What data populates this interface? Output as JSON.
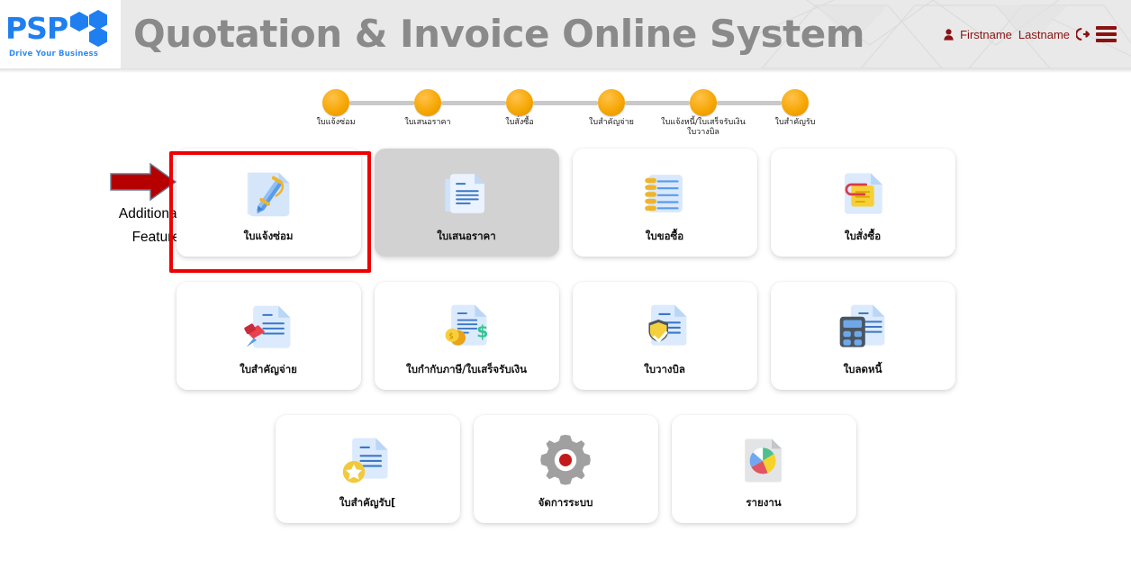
{
  "header": {
    "logo_text": "PSP",
    "logo_tagline": "Drive Your Business",
    "logo_icon": "hexagon-cluster-icon",
    "title": "Quotation & Invoice Online System",
    "user_icon": "user-icon",
    "first_name": "Firstname",
    "last_name": "Lastname",
    "logout_icon": "logout-icon",
    "menu_icon": "hamburger-menu-icon",
    "accent_color": "#8c1212",
    "title_color": "#8a8a8a",
    "bar_color": "#e9e9e9"
  },
  "stepper": {
    "dot_color": "#f5a500",
    "line_color": "#c9c9c9",
    "steps": [
      {
        "label": "ใบแจ้งซ่อม"
      },
      {
        "label": "ใบเสนอราคา"
      },
      {
        "label": "ใบสั่งซื้อ"
      },
      {
        "label": "ใบสำคัญจ่าย"
      },
      {
        "label": "ใบแจ้งหนี้/ใบเสร็จรับเงิน\nใบวางบิล"
      },
      {
        "label": "ใบสำคัญรับ"
      }
    ]
  },
  "annotation": {
    "line1": "Additional",
    "line2": "Feature",
    "arrow_icon": "right-arrow-icon",
    "arrow_color": "#b60000",
    "highlight_color": "#ee0000"
  },
  "cards": [
    {
      "label": "ใบแจ้งซ่อม",
      "icon": "document-pen-icon",
      "state": "highlighted"
    },
    {
      "label": "ใบเสนอราคา",
      "icon": "document-lines-icon",
      "state": "selected"
    },
    {
      "label": "ใบขอซื้อ",
      "icon": "notepad-icon",
      "state": "normal"
    },
    {
      "label": "ใบสั่งซื้อ",
      "icon": "document-paperclip-icon",
      "state": "normal"
    },
    {
      "label": "ใบสำคัญจ่าย",
      "icon": "document-pushpin-icon",
      "state": "normal"
    },
    {
      "label": "ใบกำกับภาษี/ใบเสร็จรับเงิน",
      "icon": "document-money-icon",
      "state": "normal"
    },
    {
      "label": "ใบวางบิล",
      "icon": "document-shield-icon",
      "state": "normal"
    },
    {
      "label": "ใบลดหนี้",
      "icon": "document-calculator-icon",
      "state": "normal"
    },
    {
      "label": "ใบสำคัญรับ[",
      "icon": "document-star-icon",
      "state": "normal"
    },
    {
      "label": "จัดการระบบ",
      "icon": "gear-icon",
      "state": "normal"
    },
    {
      "label": "รายงาน",
      "icon": "document-piechart-icon",
      "state": "normal"
    }
  ]
}
